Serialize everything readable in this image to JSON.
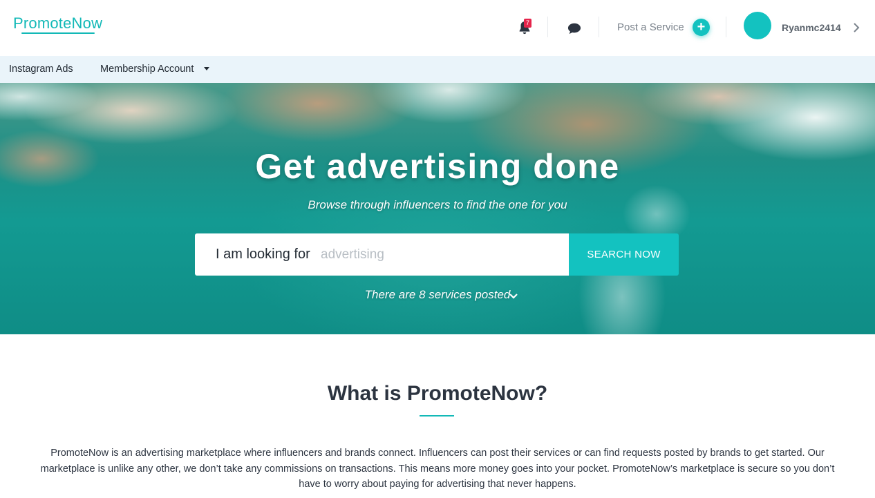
{
  "header": {
    "logo": "PromoteNow",
    "notifications_count": "7",
    "post_service_label": "Post a Service",
    "plus_symbol": "+",
    "username": "Ryanmc2414"
  },
  "nav": {
    "items": [
      {
        "label": "Instagram Ads"
      },
      {
        "label": "Membership Account"
      }
    ]
  },
  "hero": {
    "title": "Get advertising done",
    "subtitle": "Browse through influencers to find the one for you",
    "search_prefix": "I am looking for",
    "search_placeholder": "advertising",
    "search_button": "SEARCH NOW",
    "services_text": "There are 8 services posted"
  },
  "about": {
    "title": "What is PromoteNow?",
    "body": "PromoteNow is an advertising marketplace where influencers and brands connect. Influencers can post their services or can find requests posted by brands to get started. Our marketplace is unlike any other, we don’t take any commissions on transactions. This means more money goes into your pocket. PromoteNow’s marketplace is secure so you don’t have to worry about paying for advertising that never happens."
  },
  "colors": {
    "accent": "#13c2c0",
    "badge": "#e5244b",
    "subnav_bg": "#eaf4fa"
  },
  "icons": [
    "bell-icon",
    "chat-icon",
    "plus-icon",
    "chevron-right-icon",
    "caret-down-icon",
    "chevron-down-icon"
  ]
}
